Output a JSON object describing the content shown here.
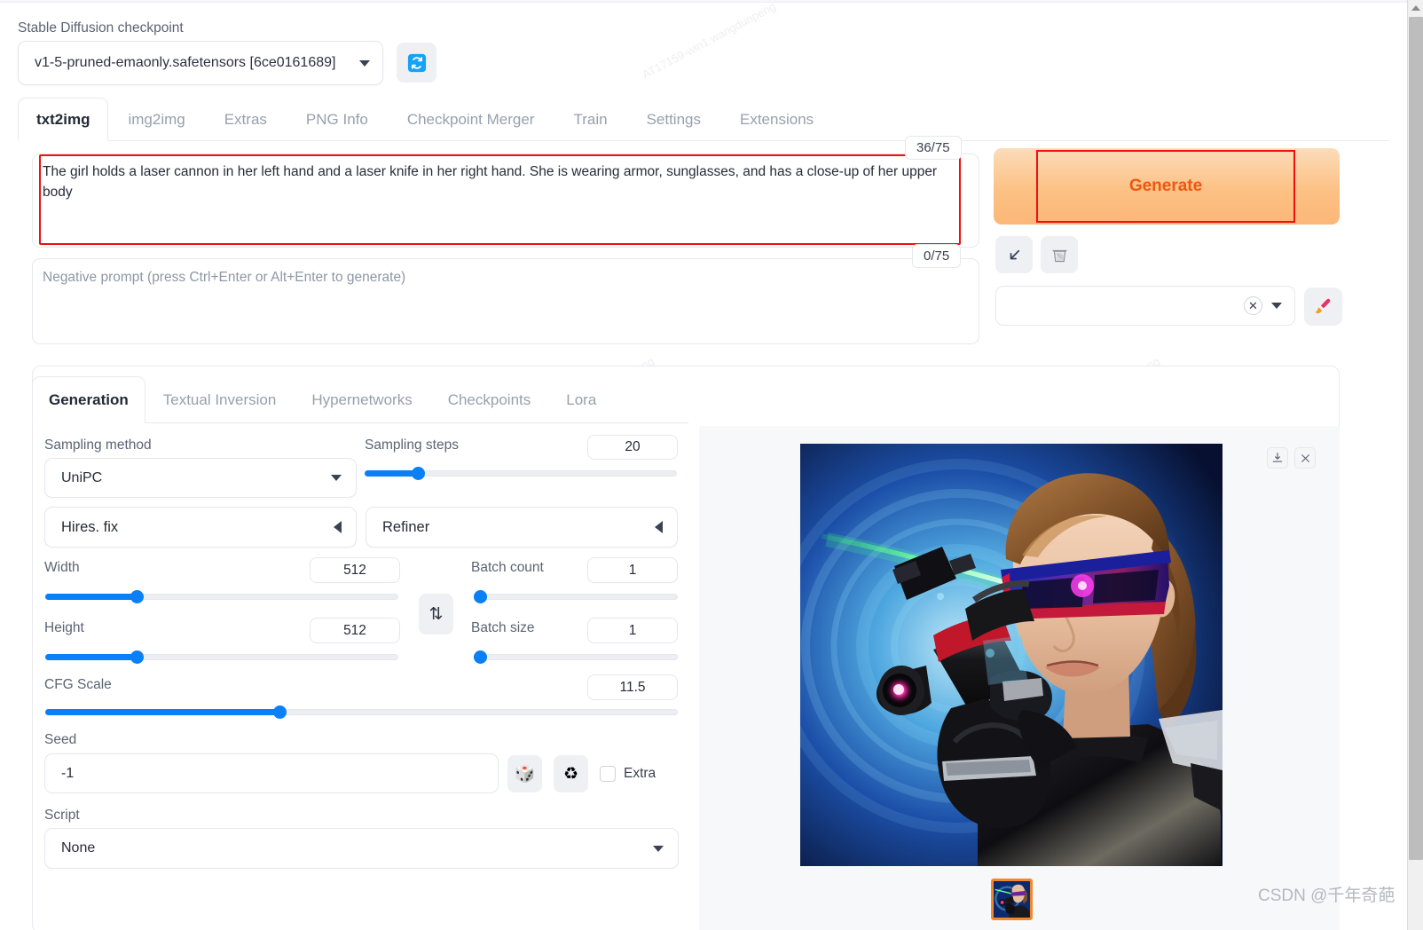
{
  "checkpoint": {
    "label": "Stable Diffusion checkpoint",
    "value": "v1-5-pruned-emaonly.safetensors [6ce0161689]",
    "refresh_icon": "refresh-icon"
  },
  "main_tabs": [
    {
      "label": "txt2img",
      "active": true
    },
    {
      "label": "img2img",
      "active": false
    },
    {
      "label": "Extras",
      "active": false
    },
    {
      "label": "PNG Info",
      "active": false
    },
    {
      "label": "Checkpoint Merger",
      "active": false
    },
    {
      "label": "Train",
      "active": false
    },
    {
      "label": "Settings",
      "active": false
    },
    {
      "label": "Extensions",
      "active": false
    }
  ],
  "prompt": {
    "value": "The girl holds a laser cannon in her left hand and a laser knife in her right hand. She is wearing armor, sunglasses, and has a close-up of her upper body",
    "token_count": "36/75"
  },
  "negative_prompt": {
    "placeholder": "Negative prompt (press Ctrl+Enter or Alt+Enter to generate)",
    "value": "",
    "token_count": "0/75"
  },
  "actions": {
    "generate_label": "Generate",
    "arrow_icon": "arrow-down-left-icon",
    "trash_icon": "trash-icon",
    "paint_icon": "paintbrush-icon",
    "styles_value": "",
    "styles_clear_icon": "clear-x-icon"
  },
  "generation_tabs": [
    {
      "label": "Generation",
      "active": true
    },
    {
      "label": "Textual Inversion",
      "active": false
    },
    {
      "label": "Hypernetworks",
      "active": false
    },
    {
      "label": "Checkpoints",
      "active": false
    },
    {
      "label": "Lora",
      "active": false
    }
  ],
  "settings": {
    "sampling_method_label": "Sampling method",
    "sampling_method_value": "UniPC",
    "sampling_steps_label": "Sampling steps",
    "sampling_steps_value": "20",
    "sampling_steps_pct": 17,
    "hires_fix_label": "Hires. fix",
    "refiner_label": "Refiner",
    "width_label": "Width",
    "width_value": "512",
    "width_pct": 26,
    "height_label": "Height",
    "height_value": "512",
    "height_pct": 26,
    "batch_count_label": "Batch count",
    "batch_count_value": "1",
    "batch_count_pct": 1,
    "batch_size_label": "Batch size",
    "batch_size_value": "1",
    "batch_size_pct": 1,
    "cfg_scale_label": "CFG Scale",
    "cfg_scale_value": "11.5",
    "cfg_scale_pct": 37,
    "seed_label": "Seed",
    "seed_value": "-1",
    "dice_icon": "dice-icon",
    "recycle_icon": "recycle-icon",
    "extra_label": "Extra",
    "extra_checked": false,
    "script_label": "Script",
    "script_value": "None",
    "swap_icon": "swap-dimensions-icon"
  },
  "result": {
    "download_icon": "download-icon",
    "close_icon": "close-icon",
    "image_alt": "generated-image-girl-with-laser-cannon",
    "thumbnail_alt": "result-thumbnail"
  },
  "watermark": {
    "csdn": "CSDN @千年奇葩",
    "tile": "AT17159-win1 wangdunpeng"
  },
  "colors": {
    "accent_blue": "#0b7ff5",
    "generate_orange": "#ef5711",
    "generate_bg": "#fbc184",
    "annotation_red": "#f10f0f",
    "thumb_border": "#f0882c"
  }
}
